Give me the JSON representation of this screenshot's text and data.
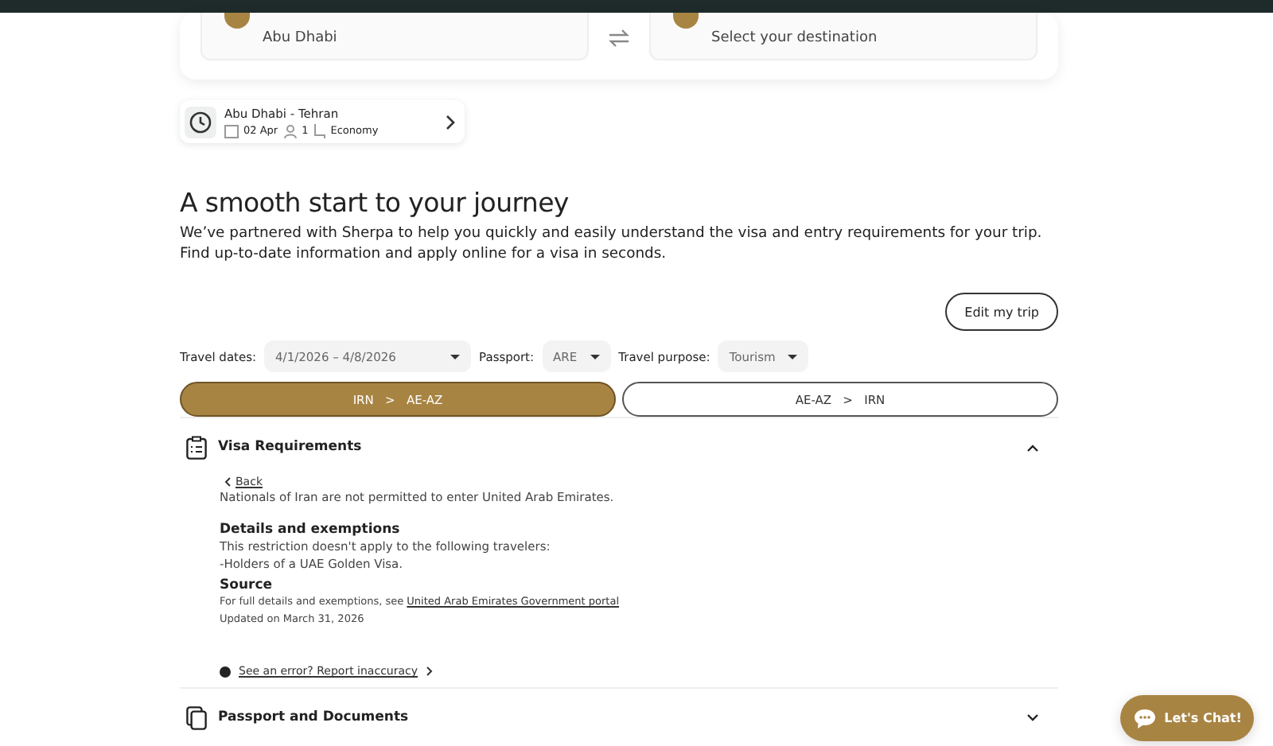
{
  "search_card": {
    "origin": {
      "city": "Abu Dhabi"
    },
    "destination": {
      "placeholder": "Select your destination"
    }
  },
  "recent_search": {
    "route": "Abu Dhabi - Tehran",
    "date": "02 Apr",
    "passengers": "1",
    "cabin": "Economy"
  },
  "heading": "A smooth start to your journey",
  "intro": "We’ve partnered with Sherpa to help you quickly and easily understand the visa and entry requirements for your trip. Find up-to-date information and apply online for a visa in seconds.",
  "edit_button": "Edit my trip",
  "filters": [
    {
      "label": "Travel dates:",
      "value": "4/1/2026 – 4/8/2026"
    },
    {
      "label": "Passport:",
      "value": "ARE"
    },
    {
      "label": "Travel purpose:",
      "value": "Tourism"
    }
  ],
  "legs": [
    {
      "from": "IRN",
      "sep": ">",
      "to": "AE-AZ",
      "selected": true
    },
    {
      "from": "AE-AZ",
      "sep": ">",
      "to": "IRN",
      "selected": false
    }
  ],
  "sections": [
    {
      "title": "Visa Requirements",
      "expanded": true,
      "back": "Back",
      "notice": "Nationals of Iran are not permitted to enter United Arab Emirates.",
      "details_title": "Details and exemptions",
      "details": [
        "This restriction doesn't apply to the following travelers:",
        "-Holders of a UAE Golden Visa."
      ],
      "source_title": "Source",
      "source_text": "For full details and exemptions, see",
      "source_link": "United Arab Emirates Government portal",
      "updated": "Updated on March 31, 2026",
      "report": "See an error? Report inaccuracy"
    },
    {
      "title": "Passport and Documents",
      "expanded": false
    }
  ],
  "chat_button": "Let's Chat!"
}
